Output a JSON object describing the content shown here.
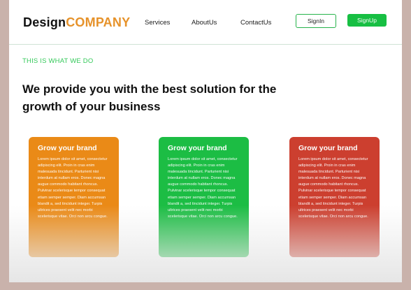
{
  "header": {
    "logo_part1": "Design",
    "logo_part2": "COMPANY",
    "nav": [
      "Services",
      "AboutUs",
      "ContactUs"
    ],
    "signin": "SignIn",
    "signup": "SignUp"
  },
  "hero": {
    "eyebrow": "THIS IS WHAT WE DO",
    "headline": "We provide you with the best solution for the growth of your business"
  },
  "cards": [
    {
      "title": "Grow your brand",
      "color": "#ea8a17",
      "body": "Lorem ipsum dolor sit amet, consectetur adipiscing elit. Proin in cras enim malesuada tincidunt. Parturient nisi interdum at nullam eros. Donec magna augue commodo habitant rhoncus. Pulvinar scelerisque tempor consequat etiam semper semper. Diam accumsan blandit a, sed tincidunt integer. Turpis ultrices praesent velit nec morbi scelerisque vitae. Orci non arcu congue."
    },
    {
      "title": "Grow your brand",
      "color": "#1cbd44",
      "body": "Lorem ipsum dolor sit amet, consectetur adipiscing elit. Proin in cras enim malesuada tincidunt. Parturient nisi interdum at nullam eros. Donec magna augue commodo habitant rhoncus. Pulvinar scelerisque tempor consequat etiam semper semper. Diam accumsan blandit a, sed tincidunt integer. Turpis ultrices praesent velit nec morbi scelerisque vitae. Orci non arcu congue."
    },
    {
      "title": "Grow your brand",
      "color": "#cc3f2f",
      "body": "Lorem ipsum dolor sit amet, consectetur adipiscing elit. Proin in cras enim malesuada tincidunt. Parturient nisi interdum at nullam eros. Donec magna augue commodo habitant rhoncus. Pulvinar scelerisque tempor consequat etiam semper semper. Diam accumsan blandit a, sed tincidunt integer. Turpis ultrices praesent velit nec morbi scelerisque vitae. Orci non arcu congue."
    }
  ]
}
